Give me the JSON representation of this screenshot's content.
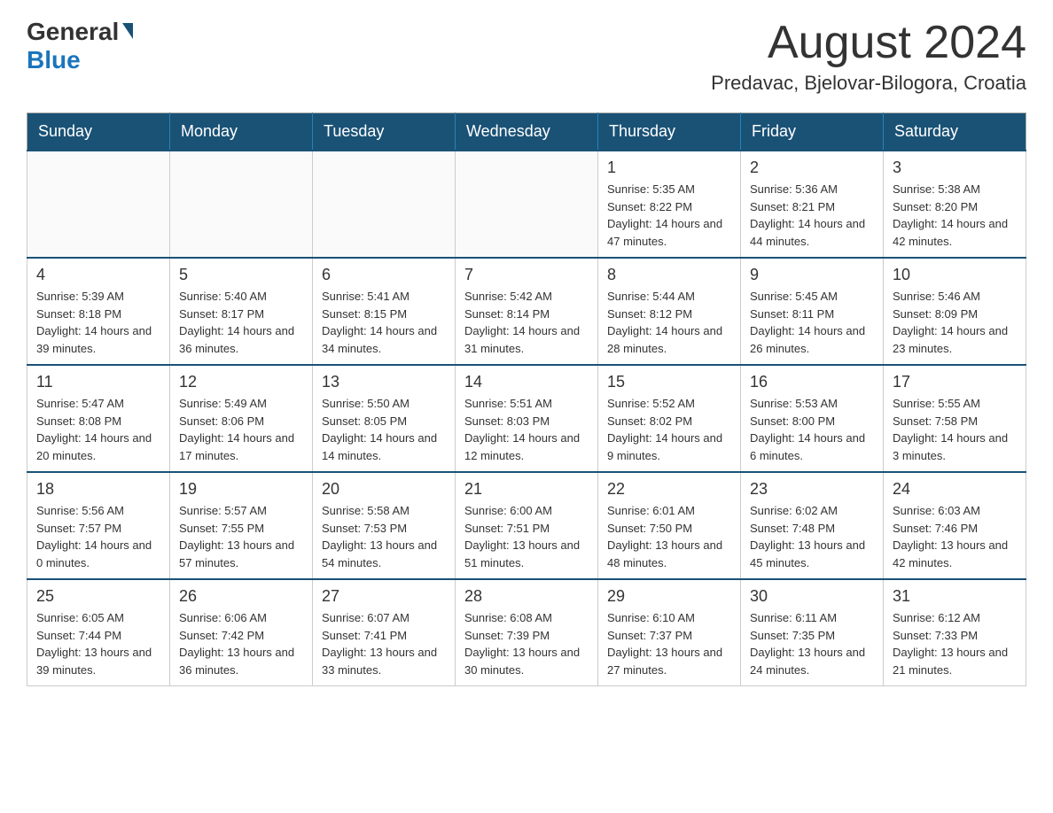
{
  "header": {
    "logo_general": "General",
    "logo_blue": "Blue",
    "month_title": "August 2024",
    "location": "Predavac, Bjelovar-Bilogora, Croatia"
  },
  "days_of_week": [
    "Sunday",
    "Monday",
    "Tuesday",
    "Wednesday",
    "Thursday",
    "Friday",
    "Saturday"
  ],
  "weeks": [
    [
      {
        "day": "",
        "info": ""
      },
      {
        "day": "",
        "info": ""
      },
      {
        "day": "",
        "info": ""
      },
      {
        "day": "",
        "info": ""
      },
      {
        "day": "1",
        "info": "Sunrise: 5:35 AM\nSunset: 8:22 PM\nDaylight: 14 hours and 47 minutes."
      },
      {
        "day": "2",
        "info": "Sunrise: 5:36 AM\nSunset: 8:21 PM\nDaylight: 14 hours and 44 minutes."
      },
      {
        "day": "3",
        "info": "Sunrise: 5:38 AM\nSunset: 8:20 PM\nDaylight: 14 hours and 42 minutes."
      }
    ],
    [
      {
        "day": "4",
        "info": "Sunrise: 5:39 AM\nSunset: 8:18 PM\nDaylight: 14 hours and 39 minutes."
      },
      {
        "day": "5",
        "info": "Sunrise: 5:40 AM\nSunset: 8:17 PM\nDaylight: 14 hours and 36 minutes."
      },
      {
        "day": "6",
        "info": "Sunrise: 5:41 AM\nSunset: 8:15 PM\nDaylight: 14 hours and 34 minutes."
      },
      {
        "day": "7",
        "info": "Sunrise: 5:42 AM\nSunset: 8:14 PM\nDaylight: 14 hours and 31 minutes."
      },
      {
        "day": "8",
        "info": "Sunrise: 5:44 AM\nSunset: 8:12 PM\nDaylight: 14 hours and 28 minutes."
      },
      {
        "day": "9",
        "info": "Sunrise: 5:45 AM\nSunset: 8:11 PM\nDaylight: 14 hours and 26 minutes."
      },
      {
        "day": "10",
        "info": "Sunrise: 5:46 AM\nSunset: 8:09 PM\nDaylight: 14 hours and 23 minutes."
      }
    ],
    [
      {
        "day": "11",
        "info": "Sunrise: 5:47 AM\nSunset: 8:08 PM\nDaylight: 14 hours and 20 minutes."
      },
      {
        "day": "12",
        "info": "Sunrise: 5:49 AM\nSunset: 8:06 PM\nDaylight: 14 hours and 17 minutes."
      },
      {
        "day": "13",
        "info": "Sunrise: 5:50 AM\nSunset: 8:05 PM\nDaylight: 14 hours and 14 minutes."
      },
      {
        "day": "14",
        "info": "Sunrise: 5:51 AM\nSunset: 8:03 PM\nDaylight: 14 hours and 12 minutes."
      },
      {
        "day": "15",
        "info": "Sunrise: 5:52 AM\nSunset: 8:02 PM\nDaylight: 14 hours and 9 minutes."
      },
      {
        "day": "16",
        "info": "Sunrise: 5:53 AM\nSunset: 8:00 PM\nDaylight: 14 hours and 6 minutes."
      },
      {
        "day": "17",
        "info": "Sunrise: 5:55 AM\nSunset: 7:58 PM\nDaylight: 14 hours and 3 minutes."
      }
    ],
    [
      {
        "day": "18",
        "info": "Sunrise: 5:56 AM\nSunset: 7:57 PM\nDaylight: 14 hours and 0 minutes."
      },
      {
        "day": "19",
        "info": "Sunrise: 5:57 AM\nSunset: 7:55 PM\nDaylight: 13 hours and 57 minutes."
      },
      {
        "day": "20",
        "info": "Sunrise: 5:58 AM\nSunset: 7:53 PM\nDaylight: 13 hours and 54 minutes."
      },
      {
        "day": "21",
        "info": "Sunrise: 6:00 AM\nSunset: 7:51 PM\nDaylight: 13 hours and 51 minutes."
      },
      {
        "day": "22",
        "info": "Sunrise: 6:01 AM\nSunset: 7:50 PM\nDaylight: 13 hours and 48 minutes."
      },
      {
        "day": "23",
        "info": "Sunrise: 6:02 AM\nSunset: 7:48 PM\nDaylight: 13 hours and 45 minutes."
      },
      {
        "day": "24",
        "info": "Sunrise: 6:03 AM\nSunset: 7:46 PM\nDaylight: 13 hours and 42 minutes."
      }
    ],
    [
      {
        "day": "25",
        "info": "Sunrise: 6:05 AM\nSunset: 7:44 PM\nDaylight: 13 hours and 39 minutes."
      },
      {
        "day": "26",
        "info": "Sunrise: 6:06 AM\nSunset: 7:42 PM\nDaylight: 13 hours and 36 minutes."
      },
      {
        "day": "27",
        "info": "Sunrise: 6:07 AM\nSunset: 7:41 PM\nDaylight: 13 hours and 33 minutes."
      },
      {
        "day": "28",
        "info": "Sunrise: 6:08 AM\nSunset: 7:39 PM\nDaylight: 13 hours and 30 minutes."
      },
      {
        "day": "29",
        "info": "Sunrise: 6:10 AM\nSunset: 7:37 PM\nDaylight: 13 hours and 27 minutes."
      },
      {
        "day": "30",
        "info": "Sunrise: 6:11 AM\nSunset: 7:35 PM\nDaylight: 13 hours and 24 minutes."
      },
      {
        "day": "31",
        "info": "Sunrise: 6:12 AM\nSunset: 7:33 PM\nDaylight: 13 hours and 21 minutes."
      }
    ]
  ]
}
